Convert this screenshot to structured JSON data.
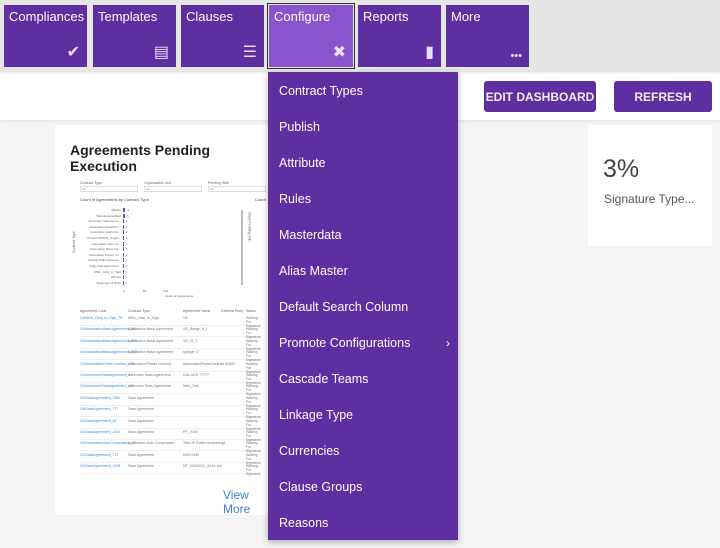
{
  "nav": {
    "tiles": [
      {
        "label": "Compliances",
        "icon": "double-check-icon",
        "glyph": "✔"
      },
      {
        "label": "Templates",
        "icon": "document-icon",
        "glyph": "▤"
      },
      {
        "label": "Clauses",
        "icon": "align-left-icon",
        "glyph": "☰"
      },
      {
        "label": "Configure",
        "icon": "tools-icon",
        "glyph": "✖"
      },
      {
        "label": "Reports",
        "icon": "clipboard-icon",
        "glyph": "▮"
      },
      {
        "label": "More",
        "icon": "more-icon",
        "glyph": "•••"
      }
    ]
  },
  "header": {
    "edit_dashboard": "EDIT DASHBOARD",
    "refresh": "REFRESH"
  },
  "widget": {
    "title": "Agreements Pending Execution",
    "view_more": "View More",
    "filters": [
      {
        "label": "Contract Type",
        "value": "All"
      },
      {
        "label": "Organization Unit",
        "value": "All"
      },
      {
        "label": "Pending With",
        "value": "All"
      }
    ],
    "chart_title": "Count of Agreements by Contract Type",
    "chart_title2": "Count",
    "xlabel": "Count of Agreements",
    "ylabel": "Contract Type",
    "ylabel2": "Days Pending with",
    "ticks": [
      "0",
      "50",
      "100"
    ],
    "bars": [
      {
        "label": "(Blank)",
        "value": 6
      },
      {
        "label": "WebsiteAgreeBest",
        "value": 5
      },
      {
        "label": "Accenture Saas Agree...",
        "value": 2
      },
      {
        "label": "Automation ExcelTem...",
        "value": 2
      },
      {
        "label": "Automation Authentic...",
        "value": 2
      },
      {
        "label": "Product 3MO06_Single...",
        "value": 2
      },
      {
        "label": "Automation Auto Co...",
        "value": 1
      },
      {
        "label": "Automation Basic Agr...",
        "value": 1
      },
      {
        "label": "Automation Printer Co...",
        "value": 1
      },
      {
        "label": "Clinical Trials Agreeme...",
        "value": 1
      },
      {
        "label": "Folgo Test Agreement...",
        "value": 1
      },
      {
        "label": "MSA_Click_to_Sign",
        "value": 1
      },
      {
        "label": "OB test",
        "value": 1
      },
      {
        "label": "Statement of Work",
        "value": 1
      }
    ],
    "columns": [
      "Agreement Code",
      "Contract Type",
      "Agreement Name",
      "External Party",
      "Status"
    ],
    "rows": [
      [
        "CMMSA_Click_to_Sign_78",
        "MSA_Click_to_Sign",
        "VB",
        "Waiting For Signature"
      ],
      [
        "CMAutomationBasicAgreement_402",
        "Automation Basic Agreement",
        "VB_Range_0_1",
        "Waiting For Signature"
      ],
      [
        "CMAutomationBasicAgreement_473",
        "Automation Basic Agreement",
        "VB_31_2",
        "Waiting For Signature"
      ],
      [
        "CMAutomationBasicAgreement_423",
        "Automation Basic Agreement",
        "spdope 17",
        "Waiting For Signature"
      ],
      [
        "CMAutomationPrinterContract_109",
        "Automation Printer Contract",
        "AutomationPrinterContract 90893",
        "Waiting For Signature"
      ],
      [
        "CMAccentureSaasAgreement_21",
        "Accenture Saas Agreement",
        "CNL AGR 77777",
        "Waiting For Signature"
      ],
      [
        "CMAccentureSaasAgreement_130",
        "Accenture Saas Agreement",
        "New_Test",
        "Waiting For Signature"
      ],
      [
        "CMSaasAgreement_1380",
        "Saas Agreement",
        "",
        "Waiting For Signature"
      ],
      [
        "CMSaasAgreement_777",
        "Saas Agreement",
        "",
        "Waiting For Signature"
      ],
      [
        "CMSaasAgreement_89",
        "Saas Agreement",
        "",
        "Waiting For Signature"
      ],
      [
        "CMSaasAgreement_1402",
        "Saas Agreement",
        "PP_7045",
        "Waiting For Signature"
      ],
      [
        "CMAutomationAutoComputation_22",
        "Automation Auto Computation",
        "Test UP Rubin Numbering2",
        "Waiting For Signature"
      ],
      [
        "CMSaasAgreement_772",
        "Saas Agreement",
        "NSN 0490",
        "Waiting For Signature"
      ],
      [
        "CMSaasAgreement_1408",
        "Saas Agreement",
        "DP_20231011_34:51 pdf",
        "Waiting For Signature"
      ]
    ]
  },
  "kpi": {
    "value": "3%",
    "label": "Signature Type..."
  },
  "menu": {
    "items": [
      {
        "label": "Contract Types"
      },
      {
        "label": "Publish"
      },
      {
        "label": "Attribute"
      },
      {
        "label": "Rules"
      },
      {
        "label": "Masterdata"
      },
      {
        "label": "Alias Master"
      },
      {
        "label": "Default Search Column"
      },
      {
        "label": "Promote Configurations",
        "submenu": true
      },
      {
        "label": "Cascade Teams"
      },
      {
        "label": "Linkage Type"
      },
      {
        "label": "Currencies"
      },
      {
        "label": "Clause Groups"
      },
      {
        "label": "Reasons"
      }
    ]
  },
  "colors": {
    "primary": "#5f2ea1",
    "active_tile": "#8a55cc"
  }
}
